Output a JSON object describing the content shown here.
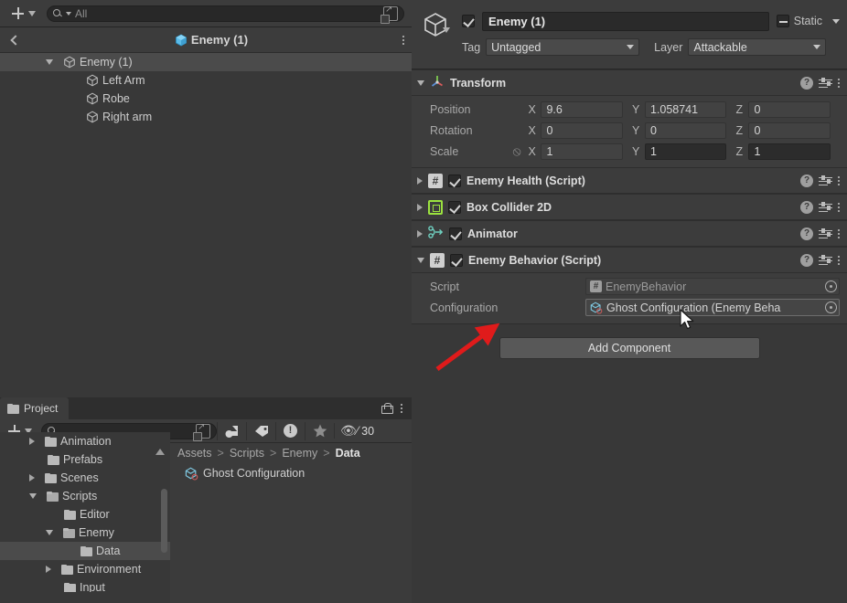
{
  "hierarchy": {
    "toolbar": {
      "create_label": "+",
      "search_placeholder": "All",
      "search_value": "",
      "search_icon": "search-icon",
      "expand_icon": "expand-icon"
    },
    "header": {
      "back_icon": "back-chevron-icon",
      "title": "Enemy (1)",
      "icon": "prefab-cube-icon",
      "menu_icon": "kebab-menu-icon"
    },
    "items": [
      {
        "label": "Enemy (1)",
        "depth": 0,
        "expanded": true,
        "selected": true,
        "icon": "gameobject-cube-icon"
      },
      {
        "label": "Left Arm",
        "depth": 1,
        "expanded": false,
        "selected": false,
        "icon": "gameobject-cube-icon"
      },
      {
        "label": "Robe",
        "depth": 1,
        "expanded": false,
        "selected": false,
        "icon": "gameobject-cube-icon"
      },
      {
        "label": "Right arm",
        "depth": 1,
        "expanded": false,
        "selected": false,
        "icon": "gameobject-cube-icon"
      }
    ]
  },
  "inspector": {
    "gameobject": {
      "enabled": true,
      "name": "Enemy (1)",
      "static_label": "Static",
      "static_state": "mixed",
      "tag_label": "Tag",
      "tag_value": "Untagged",
      "layer_label": "Layer",
      "layer_value": "Attackable"
    },
    "transform": {
      "title": "Transform",
      "expanded": true,
      "rows": [
        {
          "label": "Position",
          "x": "9.6",
          "y": "1.058741",
          "z": "0",
          "highlight": [
            false,
            false,
            false
          ]
        },
        {
          "label": "Rotation",
          "x": "0",
          "y": "0",
          "z": "0",
          "highlight": [
            false,
            false,
            false
          ]
        },
        {
          "label": "Scale",
          "x": "1",
          "y": "1",
          "z": "1",
          "highlight": [
            false,
            true,
            true
          ],
          "link_icon": "constrain-proportions-off-icon"
        }
      ],
      "axis_labels": [
        "X",
        "Y",
        "Z"
      ]
    },
    "components": [
      {
        "title": "Enemy Health (Script)",
        "enabled": true,
        "expanded": false,
        "icon": "script-icon"
      },
      {
        "title": "Box Collider 2D",
        "enabled": true,
        "expanded": false,
        "icon": "box-collider-2d-icon"
      },
      {
        "title": "Animator",
        "enabled": true,
        "expanded": false,
        "icon": "animator-icon"
      },
      {
        "title": "Enemy Behavior (Script)",
        "enabled": true,
        "expanded": true,
        "icon": "script-icon"
      }
    ],
    "enemy_behavior": {
      "fields": [
        {
          "label": "Script",
          "value": "EnemyBehavior",
          "icon": "script-icon",
          "readonly": true,
          "focused": false
        },
        {
          "label": "Configuration",
          "value": "Ghost Configuration (Enemy Beha",
          "icon": "scriptable-object-icon",
          "readonly": false,
          "focused": true
        }
      ]
    },
    "add_component_label": "Add Component",
    "icons": {
      "help": "help-icon",
      "preset": "preset-icon",
      "menu": "kebab-menu-icon"
    }
  },
  "project": {
    "tab_label": "Project",
    "tab_icon": "folder-icon",
    "lock_icon": "lock-icon",
    "menu_icon": "kebab-menu-icon",
    "toolbar": {
      "create_label": "+",
      "search_placeholder": "",
      "search_value": "",
      "buttons": [
        {
          "name": "search-by-type-icon",
          "glyph": "object"
        },
        {
          "name": "search-by-label-icon",
          "glyph": "tag"
        },
        {
          "name": "warnings-filter-icon",
          "glyph": "bang"
        },
        {
          "name": "favorites-icon",
          "glyph": "star"
        }
      ],
      "hidden_count_icon": "eye-off-icon",
      "hidden_count": "30"
    },
    "tree": [
      {
        "label": "Animation",
        "depth": 1,
        "arrow": "right",
        "selected": false,
        "clipped": true
      },
      {
        "label": "Prefabs",
        "depth": 1,
        "arrow": "none",
        "selected": false
      },
      {
        "label": "Scenes",
        "depth": 1,
        "arrow": "right",
        "selected": false
      },
      {
        "label": "Scripts",
        "depth": 1,
        "arrow": "down",
        "selected": false,
        "open_folder": true
      },
      {
        "label": "Editor",
        "depth": 2,
        "arrow": "none",
        "selected": false
      },
      {
        "label": "Enemy",
        "depth": 2,
        "arrow": "down",
        "selected": false,
        "open_folder": true
      },
      {
        "label": "Data",
        "depth": 3,
        "arrow": "none",
        "selected": true
      },
      {
        "label": "Environment",
        "depth": 2,
        "arrow": "right",
        "selected": false
      },
      {
        "label": "Input",
        "depth": 2,
        "arrow": "none",
        "selected": false
      }
    ],
    "breadcrumb": [
      "Assets",
      "Scripts",
      "Enemy",
      "Data"
    ],
    "assets": [
      {
        "label": "Ghost Configuration",
        "icon": "scriptable-object-icon"
      }
    ]
  },
  "annotation": {
    "arrow_color": "#e01b1b",
    "arrow_name": "red-pointer-arrow"
  },
  "colors": {
    "background": "#383838",
    "panel_header": "#3c3c3c",
    "selection": "#4b4b4b",
    "field": "#424242",
    "field_dark": "#2a2a2a",
    "accent_green": "#9be23f",
    "text": "#cdcdcd",
    "text_dim": "#a8a8a8"
  }
}
